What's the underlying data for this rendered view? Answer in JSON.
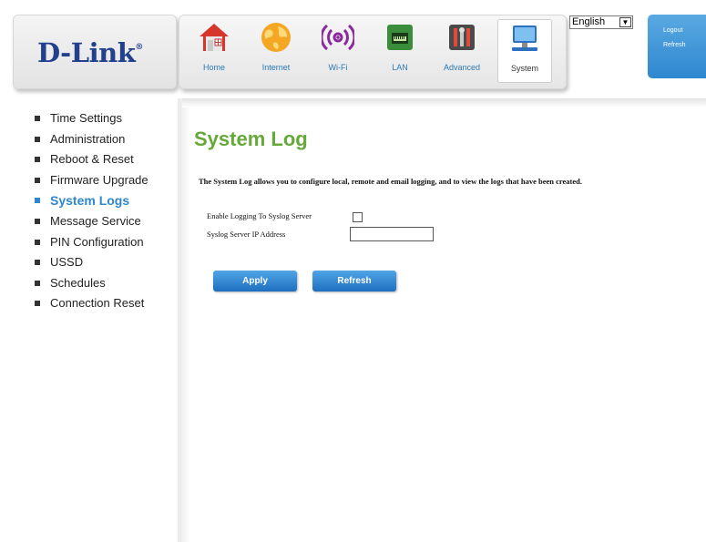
{
  "brand": {
    "logo_text": "D-Link",
    "reg_mark": "®"
  },
  "nav": {
    "items": [
      {
        "label": "Home",
        "icon": "home-icon"
      },
      {
        "label": "Internet",
        "icon": "globe-icon"
      },
      {
        "label": "Wi-Fi",
        "icon": "wifi-icon"
      },
      {
        "label": "LAN",
        "icon": "lan-port-icon"
      },
      {
        "label": "Advanced",
        "icon": "tools-icon"
      },
      {
        "label": "System",
        "icon": "computer-icon"
      }
    ],
    "active": "System"
  },
  "language": {
    "selected": "English"
  },
  "side_panel": {
    "logout": "Logout",
    "refresh": "Refresh"
  },
  "menu": {
    "items": [
      "Time Settings",
      "Administration",
      "Reboot & Reset",
      "Firmware Upgrade",
      "System Logs",
      "Message Service",
      "PIN Configuration",
      "USSD",
      "Schedules",
      "Connection Reset"
    ],
    "active": "System Logs"
  },
  "page": {
    "title": "System Log",
    "description": "The System Log allows you to configure local, remote and email logging, and to view the logs that have been created."
  },
  "form": {
    "enable_label": "Enable Logging To Syslog Server",
    "enable_checked": false,
    "ip_label": "Syslog Server IP Address",
    "ip_value": ""
  },
  "buttons": {
    "apply": "Apply",
    "refresh": "Refresh"
  },
  "colors": {
    "brand_blue": "#23408e",
    "accent_blue": "#2e87cf",
    "title_green": "#67a83a"
  }
}
